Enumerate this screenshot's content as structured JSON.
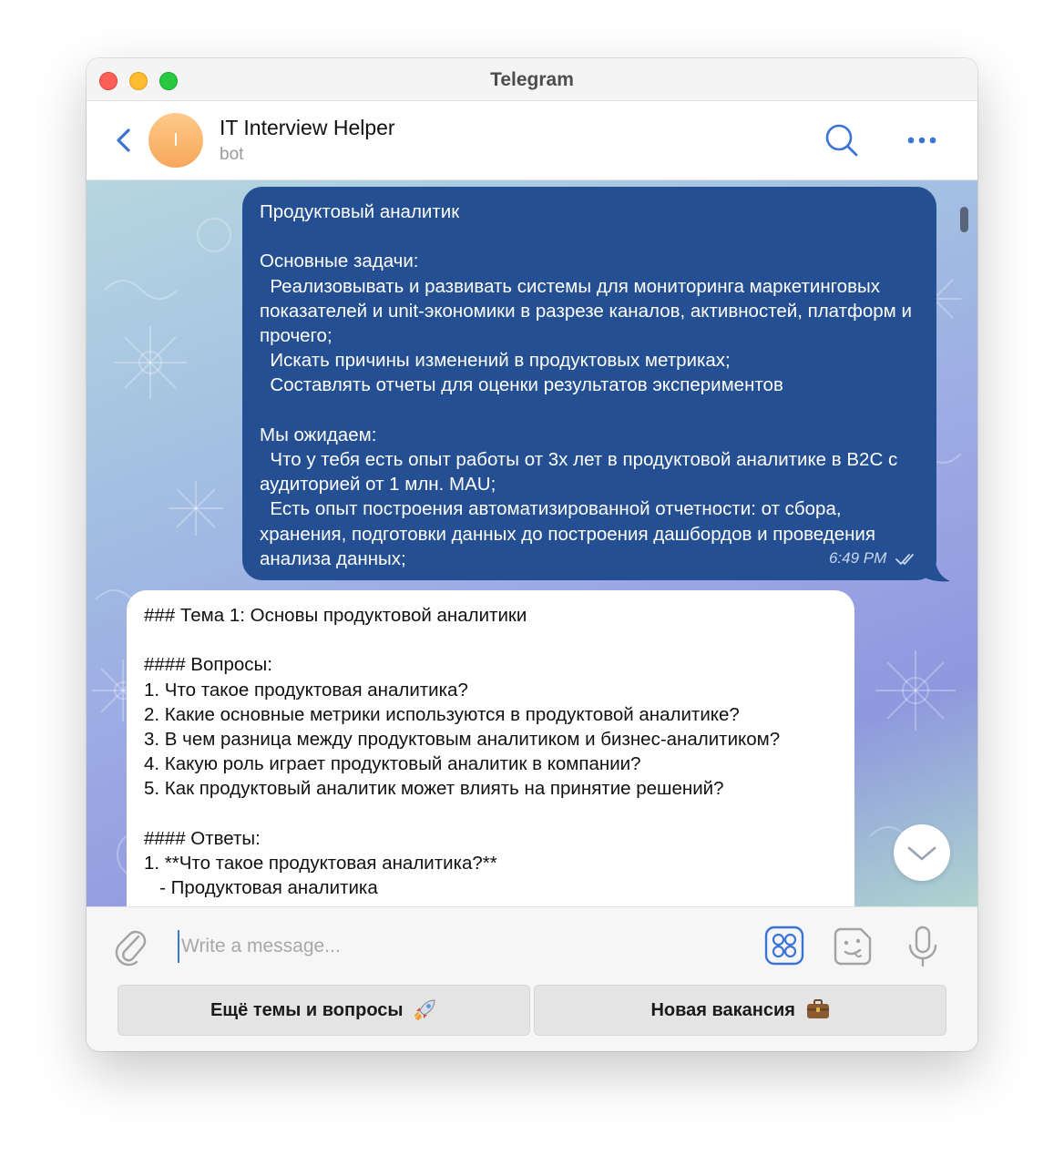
{
  "window": {
    "title": "Telegram"
  },
  "header": {
    "avatar_letter": "I",
    "chat_name": "IT Interview Helper",
    "chat_status": "bot",
    "icons": {
      "back": "chevron-left-icon",
      "search": "search-icon",
      "more": "more-dots-icon"
    }
  },
  "messages": [
    {
      "direction": "outgoing",
      "text": "Продуктовый аналитик\n\nОсновные задачи:\n  Реализовывать и развивать системы для мониторинга маркетинговых показателей и unit-экономики в разрезе каналов, активностей, платформ и прочего;\n  Искать причины изменений в продуктовых метриках;\n  Составлять отчеты для оценки результатов экспериментов\n\nМы ожидаем:\n  Что у тебя есть опыт работы от 3х лет в продуктовой аналитике в B2C с аудиторией от 1 млн. MAU;\n  Есть опыт построения автоматизированной отчетности: от сбора, хранения, подготовки данных до построения дашбордов и проведения анализа данных;",
      "time": "6:49 PM",
      "status_icon": "double-check-icon"
    },
    {
      "direction": "incoming",
      "text": "### Тема 1: Основы продуктовой аналитики\n\n#### Вопросы:\n1. Что такое продуктовая аналитика?\n2. Какие основные метрики используются в продуктовой аналитике?\n3. В чем разница между продуктовым аналитиком и бизнес-аналитиком?\n4. Какую роль играет продуктовый аналитик в компании?\n5. Как продуктовый аналитик может влиять на принятие решений?\n\n#### Ответы:\n1. **Что такое продуктовая аналитика?**\n   - Продуктовая аналитика"
    }
  ],
  "composer": {
    "placeholder": "Write a message...",
    "value": "",
    "icons": {
      "attach": "paperclip-icon",
      "commands": "bot-commands-icon",
      "sticker": "sticker-icon",
      "mic": "microphone-icon"
    }
  },
  "keyboard": {
    "buttons": [
      {
        "label": "Ещё темы и вопросы",
        "icon": "rocket-icon"
      },
      {
        "label": "Новая вакансия",
        "icon": "briefcase-icon"
      }
    ]
  },
  "colors": {
    "outgoing_bubble": "#244f93",
    "incoming_bubble": "#ffffff",
    "accent": "#3b73d6",
    "avatar": "#f6a85a"
  }
}
